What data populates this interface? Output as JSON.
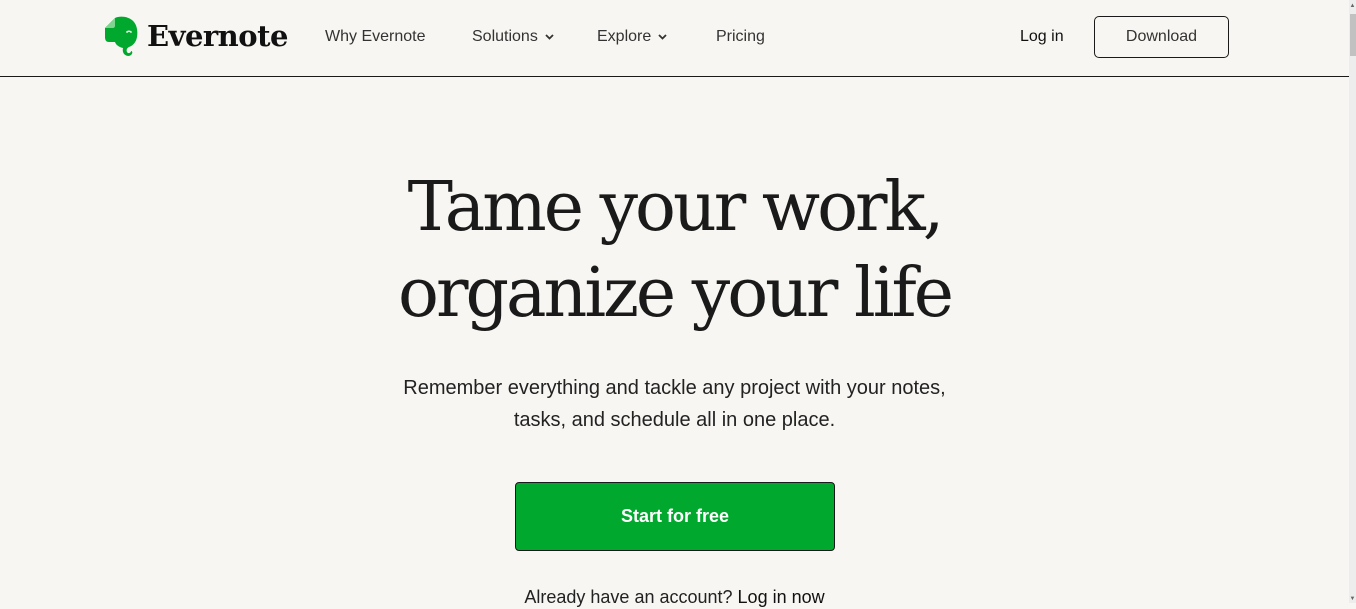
{
  "brand": {
    "name": "Evernote",
    "accent": "#00a82d"
  },
  "nav": {
    "items": [
      {
        "label": "Why Evernote",
        "has_dropdown": false
      },
      {
        "label": "Solutions",
        "has_dropdown": true
      },
      {
        "label": "Explore",
        "has_dropdown": true
      },
      {
        "label": "Pricing",
        "has_dropdown": false
      }
    ],
    "login_label": "Log in",
    "download_label": "Download"
  },
  "hero": {
    "title_line1": "Tame your work,",
    "title_line2": "organize your life",
    "subtitle_line1": "Remember everything and tackle any project with your notes,",
    "subtitle_line2": "tasks, and schedule all in one place.",
    "cta_label": "Start for free",
    "already_text": "Already have an account?",
    "login_now_label": "Log in now"
  },
  "icons": {
    "logo": "evernote-elephant-icon",
    "dropdown": "chevron-down-icon"
  }
}
